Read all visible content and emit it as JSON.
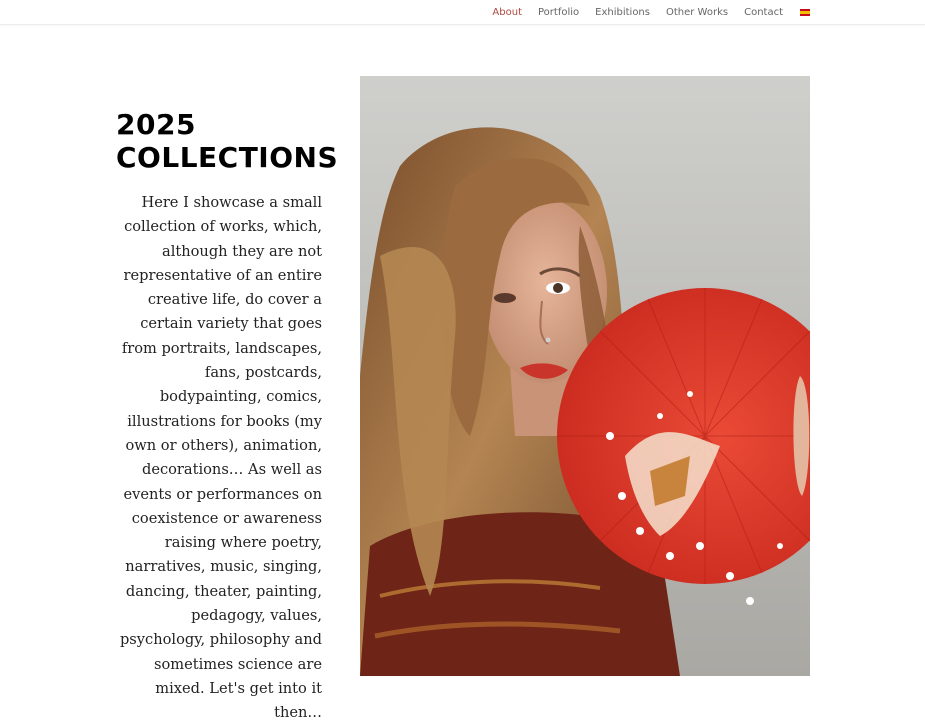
{
  "nav": {
    "items": [
      {
        "label": "About",
        "active": true
      },
      {
        "label": "Portfolio"
      },
      {
        "label": "Exhibitions"
      },
      {
        "label": "Other Works"
      },
      {
        "label": "Contact"
      }
    ],
    "language_flag": "spain-flag-icon"
  },
  "main": {
    "heading": "2025 COLLECTIONS",
    "body": "Here I showcase a small collection of works, which, although they are not representative of an entire creative life, do cover a certain variety that goes from portraits, landscapes, fans, postcards, bodypainting, comics, illustrations for books (my own or others), animation, decorations… As well as events or performances on coexistence or awareness raising where poetry, narratives, music, singing, dancing, theater, painting, pedagogy, values, psychology, philosophy and sometimes science are mixed. Let's get into it then…"
  },
  "colors": {
    "accent": "#b04a3f",
    "nav_text": "#666666",
    "fan_red": "#e03a2a"
  }
}
